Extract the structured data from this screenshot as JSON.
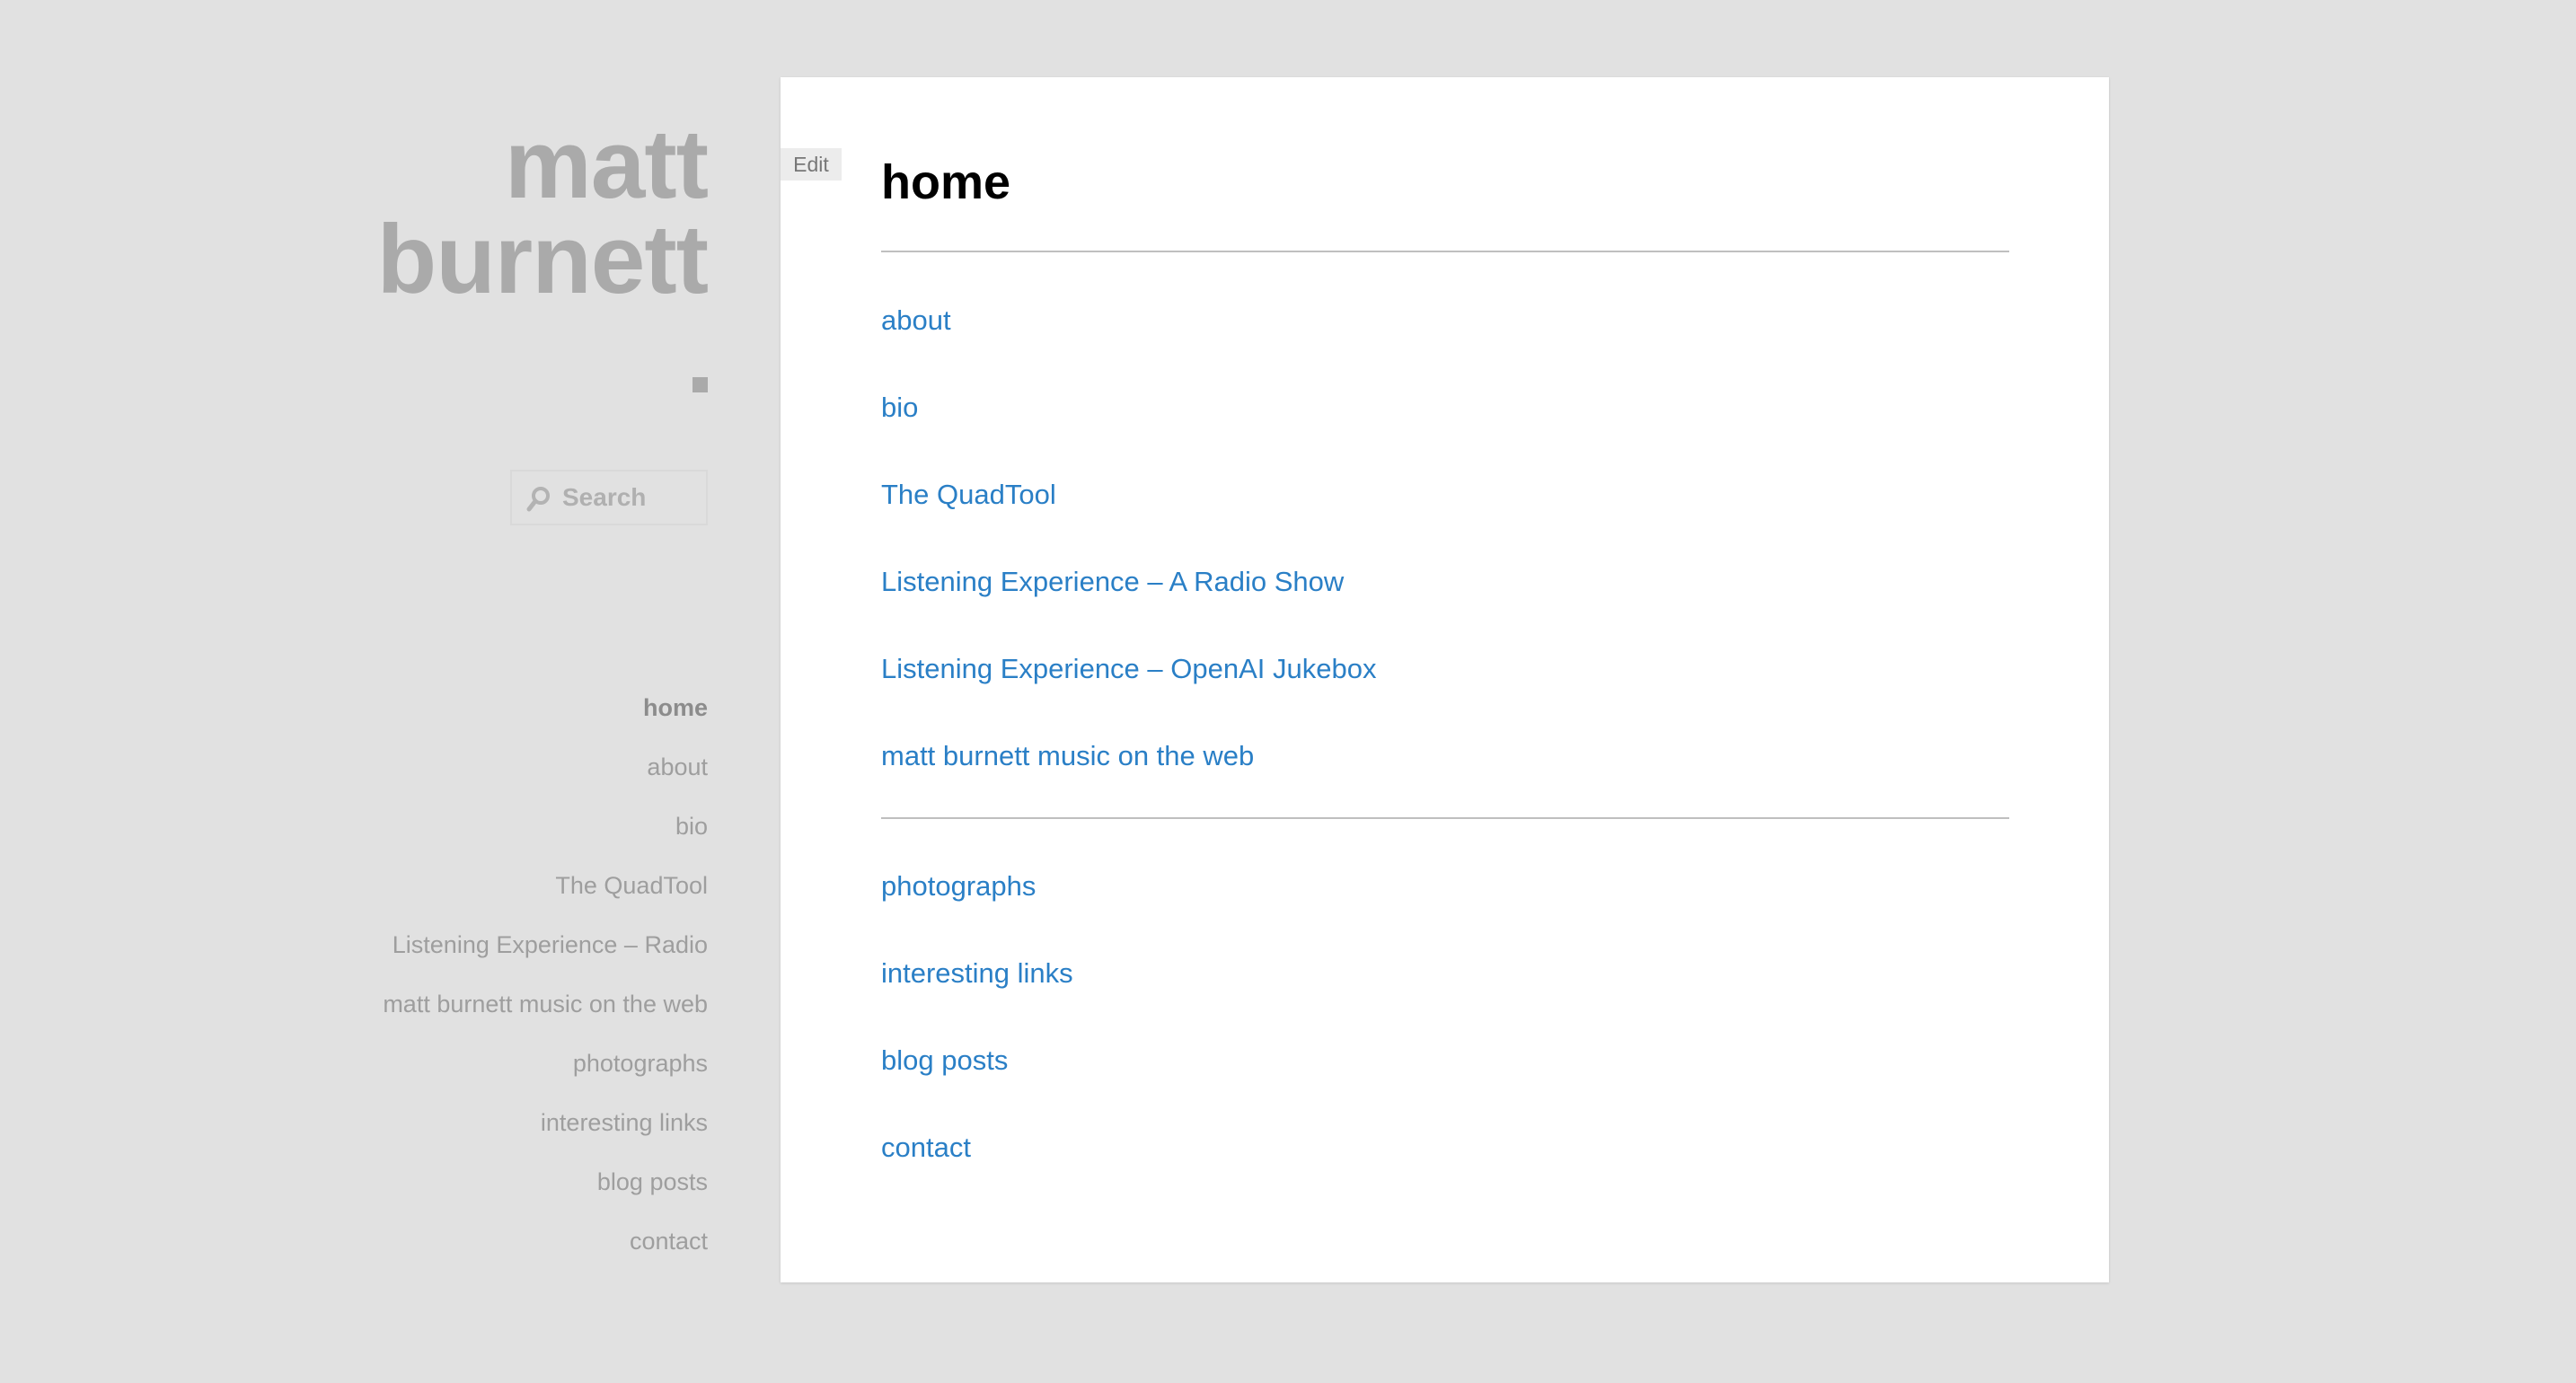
{
  "site": {
    "title_line1": "matt",
    "title_line2": "burnett"
  },
  "search": {
    "placeholder": "Search",
    "icon": "search-icon"
  },
  "sidebar": {
    "items": [
      {
        "label": "home",
        "current": true
      },
      {
        "label": "about"
      },
      {
        "label": "bio"
      },
      {
        "label": "The QuadTool"
      },
      {
        "label": "Listening Experience – Radio"
      },
      {
        "label": "matt burnett music on the web"
      },
      {
        "label": "photographs"
      },
      {
        "label": "interesting links"
      },
      {
        "label": "blog posts"
      },
      {
        "label": "contact"
      }
    ]
  },
  "main": {
    "edit_label": "Edit",
    "title": "home",
    "links_group1": [
      "about",
      "bio",
      "The QuadTool",
      "Listening Experience – A Radio Show",
      "Listening Experience – OpenAI Jukebox",
      "matt burnett music on the web"
    ],
    "links_group2": [
      "photographs",
      "interesting links",
      "blog posts",
      "contact"
    ]
  },
  "colors": {
    "background": "#e1e1e1",
    "title_gray": "#aaaaaa",
    "nav_gray": "#9e9e9e",
    "link_blue": "#2a7fc6",
    "card": "#ffffff"
  }
}
